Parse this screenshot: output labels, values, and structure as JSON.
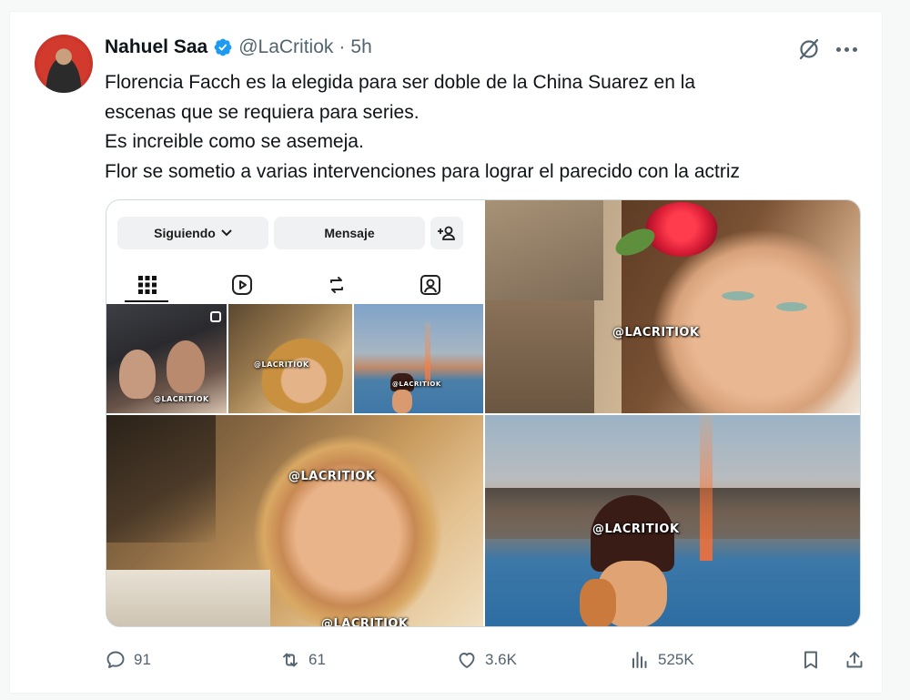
{
  "tweet": {
    "display_name": "Nahuel Saa",
    "handle": "@LaCritiok",
    "separator": "·",
    "time": "5h",
    "text_lines": [
      "Florencia Facch es la elegida para ser doble de la China Suarez en la",
      "escenas que se requiera para series.",
      "Es increible como se asemeja.",
      "Flor se sometio a varias intervenciones para lograr el parecido con la actriz"
    ]
  },
  "media": {
    "instagram": {
      "following_label": "Siguiendo",
      "message_label": "Mensaje"
    },
    "watermark": "@LACRITIOK"
  },
  "actions": {
    "replies": "91",
    "reposts": "61",
    "likes": "3.6K",
    "views": "525K"
  },
  "colors": {
    "verified": "#1d9bf0",
    "secondary_text": "#536471",
    "primary_text": "#0f1419"
  }
}
